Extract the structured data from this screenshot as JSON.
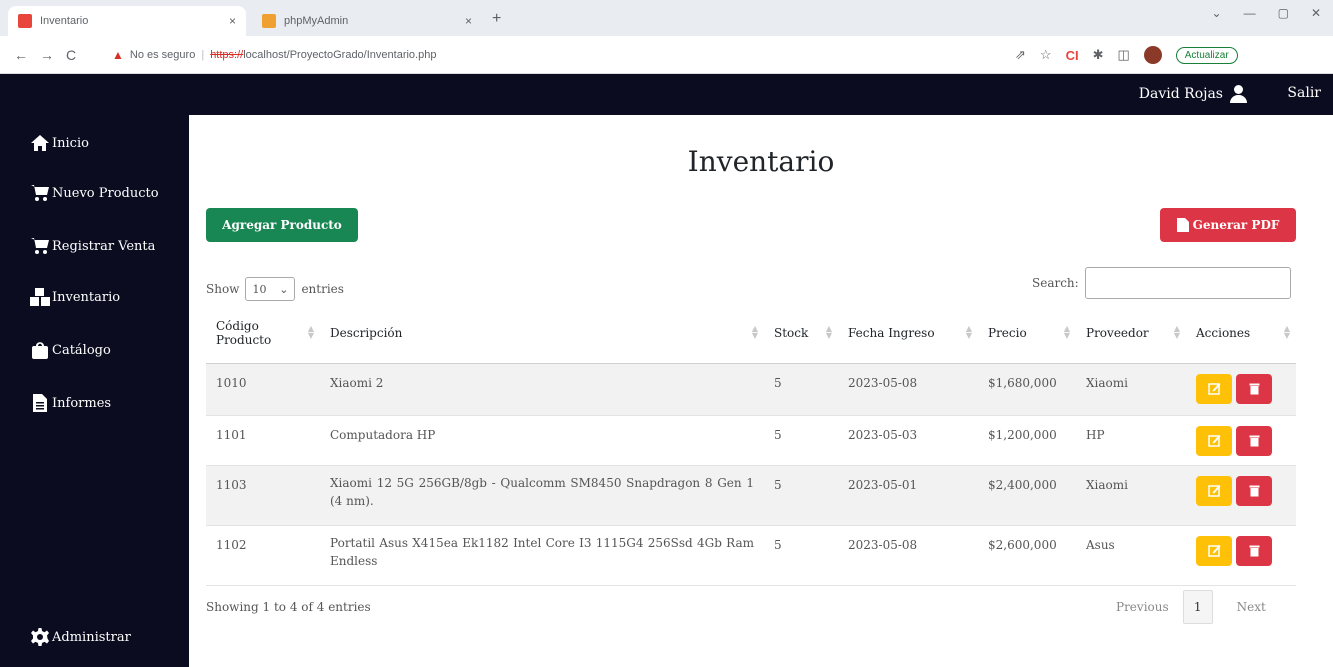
{
  "browser": {
    "tabs": [
      {
        "label": "Inventario",
        "active": true
      },
      {
        "label": "phpMyAdmin",
        "active": false
      }
    ],
    "close_glyph": "×",
    "new_tab_glyph": "+",
    "nav": {
      "back": "←",
      "forward": "→",
      "reload": "C"
    },
    "url_warning": "No es seguro",
    "url_scheme": "https://",
    "url_host": "localhost",
    "url_path": "/ProyectoGrado/Inventario.php",
    "update_label": "Actualizar",
    "icons": [
      "share-icon",
      "star-icon",
      "extension-icon",
      "puzzle-icon",
      "sidepanel-icon",
      "profile-icon"
    ]
  },
  "header": {
    "user_name": "David Rojas",
    "logout": "Salir",
    "bg_color": "#0b0c20"
  },
  "sidebar": {
    "items": [
      {
        "label": "Inicio",
        "icon": "home-icon"
      },
      {
        "label": "Nuevo Producto",
        "icon": "cart-plus-icon"
      },
      {
        "label": "Registrar Venta",
        "icon": "cart-icon"
      },
      {
        "label": "Inventario",
        "icon": "boxes-icon"
      },
      {
        "label": "Catálogo",
        "icon": "bag-icon"
      },
      {
        "label": "Informes",
        "icon": "file-icon"
      },
      {
        "label": "Administrar",
        "icon": "gear-icon"
      }
    ]
  },
  "main": {
    "title": "Inventario",
    "add_button": "Agregar Producto",
    "pdf_button": "Generar PDF",
    "show_label": "Show",
    "entries_value": "10",
    "entries_label": "entries",
    "search_label": "Search:",
    "search_value": "",
    "columns": [
      "Código Producto",
      "Descripción",
      "Stock",
      "Fecha Ingreso",
      "Precio",
      "Proveedor",
      "Acciones"
    ],
    "rows": [
      {
        "codigo": "1010",
        "descripcion": "Xiaomi 2",
        "stock": "5",
        "fecha": "2023-05-08",
        "precio": "$1,680,000",
        "proveedor": "Xiaomi"
      },
      {
        "codigo": "1101",
        "descripcion": "Computadora HP",
        "stock": "5",
        "fecha": "2023-05-03",
        "precio": "$1,200,000",
        "proveedor": "HP"
      },
      {
        "codigo": "1103",
        "descripcion": "Xiaomi 12 5G 256GB/8gb - Qualcomm SM8450 Snapdragon 8 Gen 1 (4 nm).",
        "stock": "5",
        "fecha": "2023-05-01",
        "precio": "$2,400,000",
        "proveedor": "Xiaomi"
      },
      {
        "codigo": "1102",
        "descripcion": "Portatil Asus X415ea Ek1182 Intel Core I3 1115G4 256Ssd 4Gb Ram Endless",
        "stock": "5",
        "fecha": "2023-05-08",
        "precio": "$2,600,000",
        "proveedor": "Asus"
      }
    ],
    "info": "Showing 1 to 4 of 4 entries",
    "prev": "Previous",
    "page": "1",
    "next": "Next",
    "colors": {
      "add": "#198754",
      "pdf": "#dc3545",
      "edit": "#ffc107",
      "delete": "#dc3545"
    }
  }
}
